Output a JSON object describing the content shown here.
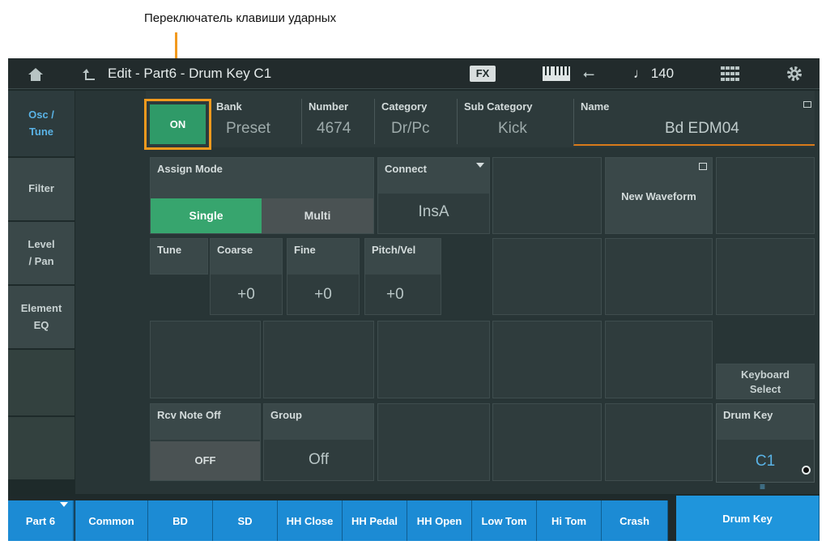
{
  "annotation": "Переключатель клавиши ударных",
  "topbar": {
    "title": "Edit - Part6 - Drum Key C1",
    "fx": "FX",
    "tempo": "♩ 140",
    "icons": [
      "home-icon",
      "back-arrow-icon",
      "keyboard-icon",
      "usb-icon",
      "grid-icon",
      "gear-icon"
    ]
  },
  "sidebar": {
    "items": [
      {
        "label_1": "Osc /",
        "label_2": "Tune"
      },
      {
        "label": "Filter"
      },
      {
        "label_1": "Level",
        "label_2": "/ Pan"
      },
      {
        "label_1": "Element",
        "label_2": "EQ"
      }
    ]
  },
  "header": {
    "switch": "ON",
    "bank": {
      "label": "Bank",
      "value": "Preset"
    },
    "number": {
      "label": "Number",
      "value": "4674"
    },
    "category": {
      "label": "Category",
      "value": "Dr/Pc"
    },
    "subcategory": {
      "label": "Sub Category",
      "value": "Kick"
    },
    "name": {
      "label": "Name",
      "value": "Bd EDM04"
    }
  },
  "assign_mode": {
    "label": "Assign Mode",
    "single": "Single",
    "multi": "Multi"
  },
  "connect": {
    "label": "Connect",
    "value": "InsA"
  },
  "new_waveform": "New Waveform",
  "tune": {
    "label": "Tune",
    "coarse": {
      "label": "Coarse",
      "value": "+0"
    },
    "fine": {
      "label": "Fine",
      "value": "+0"
    },
    "pitch_vel": {
      "label": "Pitch/Vel",
      "value": "+0"
    }
  },
  "keyboard_select": {
    "line1": "Keyboard",
    "line2": "Select"
  },
  "rcv_note_off": {
    "label": "Rcv Note Off",
    "value": "OFF"
  },
  "group": {
    "label": "Group",
    "value": "Off"
  },
  "drum_key": {
    "label": "Drum Key",
    "value": "C1"
  },
  "bottom_tabs": [
    "Part 6",
    "Common",
    "BD",
    "SD",
    "HH Close",
    "HH Pedal",
    "HH Open",
    "Low Tom",
    "Hi Tom",
    "Crash",
    "Drum Key"
  ],
  "colors": {
    "accent_green": "#37a56e",
    "accent_blue": "#1c8bd4",
    "highlight_orange": "#f29a1e"
  }
}
